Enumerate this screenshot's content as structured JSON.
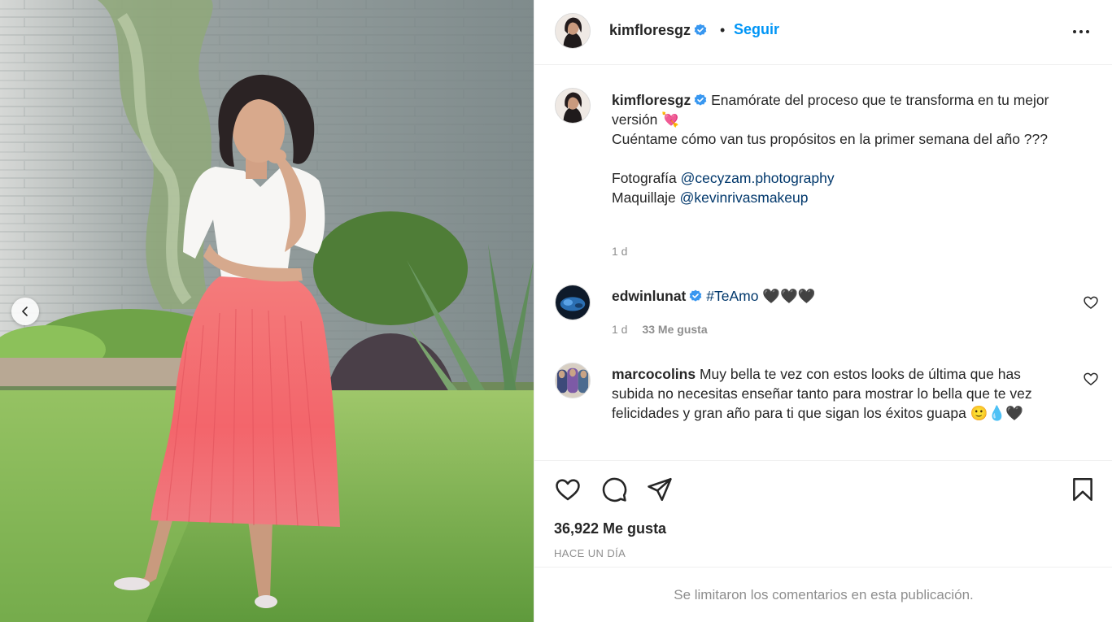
{
  "colors": {
    "link": "#00376b",
    "follow": "#0095f6",
    "muted": "#8e8e8e",
    "verified": "#3897f0"
  },
  "media": {
    "carousel_prev_icon": "chevron-left-icon"
  },
  "header": {
    "username": "kimfloresgz",
    "verified": true,
    "separator": "•",
    "follow_label": "Seguir",
    "more_icon": "more-options-icon"
  },
  "caption": {
    "username": "kimfloresgz",
    "line1": "Enamórate del proceso que te transforma en tu mejor versión",
    "emoji1": "💘",
    "line2": "Cuéntame cómo van tus propósitos en la primer semana del año ???",
    "photo_label": "Fotografía",
    "photo_mention": "@cecyzam.photography",
    "makeup_label": "Maquillaje",
    "makeup_mention": "@kevinrivasmakeup",
    "age": "1 d"
  },
  "comments": [
    {
      "username": "edwinlunat",
      "verified": true,
      "hashtag": "#TeAmo",
      "text": "🖤🖤🖤",
      "age": "1 d",
      "likes": "33 Me gusta"
    },
    {
      "username": "marcocolins",
      "verified": false,
      "text": "Muy bella te vez con estos looks de última que has subida no necesitas enseñar tanto para mostrar lo bella que te vez felicidades y gran año para ti que sigan los éxitos guapa 🙂💧🖤"
    }
  ],
  "actions": {
    "like_icon": "heart-icon",
    "comment_icon": "comment-icon",
    "share_icon": "send-icon",
    "save_icon": "bookmark-icon",
    "likes_count": "36,922 Me gusta",
    "timestamp": "HACE UN DÍA"
  },
  "footer": {
    "limited_text": "Se limitaron los comentarios en esta publicación."
  }
}
